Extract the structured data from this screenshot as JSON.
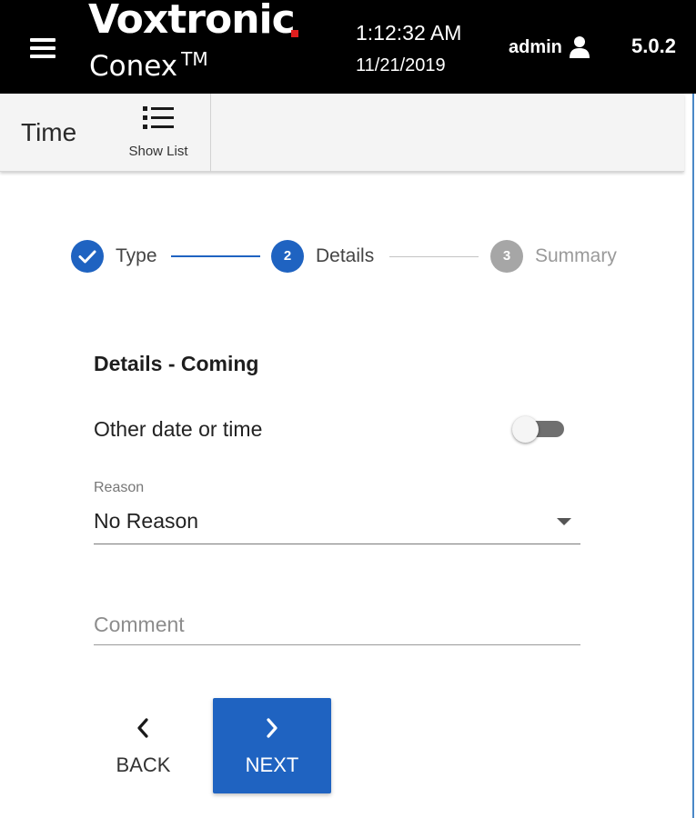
{
  "header": {
    "brand": "Voxtronic",
    "product": "Conex",
    "product_mark": "TM",
    "time": "1:12:32 AM",
    "date": "11/21/2019",
    "user": "admin",
    "version": "5.0.2",
    "brand_dot_color": "#e01e1e"
  },
  "toolbar": {
    "title": "Time",
    "show_list_label": "Show List"
  },
  "stepper": {
    "steps": [
      {
        "number": "1",
        "label": "Type",
        "state": "completed"
      },
      {
        "number": "2",
        "label": "Details",
        "state": "active"
      },
      {
        "number": "3",
        "label": "Summary",
        "state": "pending"
      }
    ],
    "active_color": "#1f63c1",
    "pending_color": "#a6a6a6"
  },
  "form": {
    "section_title": "Details - Coming",
    "toggle_label": "Other date or time",
    "toggle_on": false,
    "reason_label": "Reason",
    "reason_value": "No Reason",
    "comment_placeholder": "Comment",
    "comment_value": ""
  },
  "nav": {
    "back_label": "BACK",
    "next_label": "NEXT",
    "next_color": "#1f63c1"
  }
}
